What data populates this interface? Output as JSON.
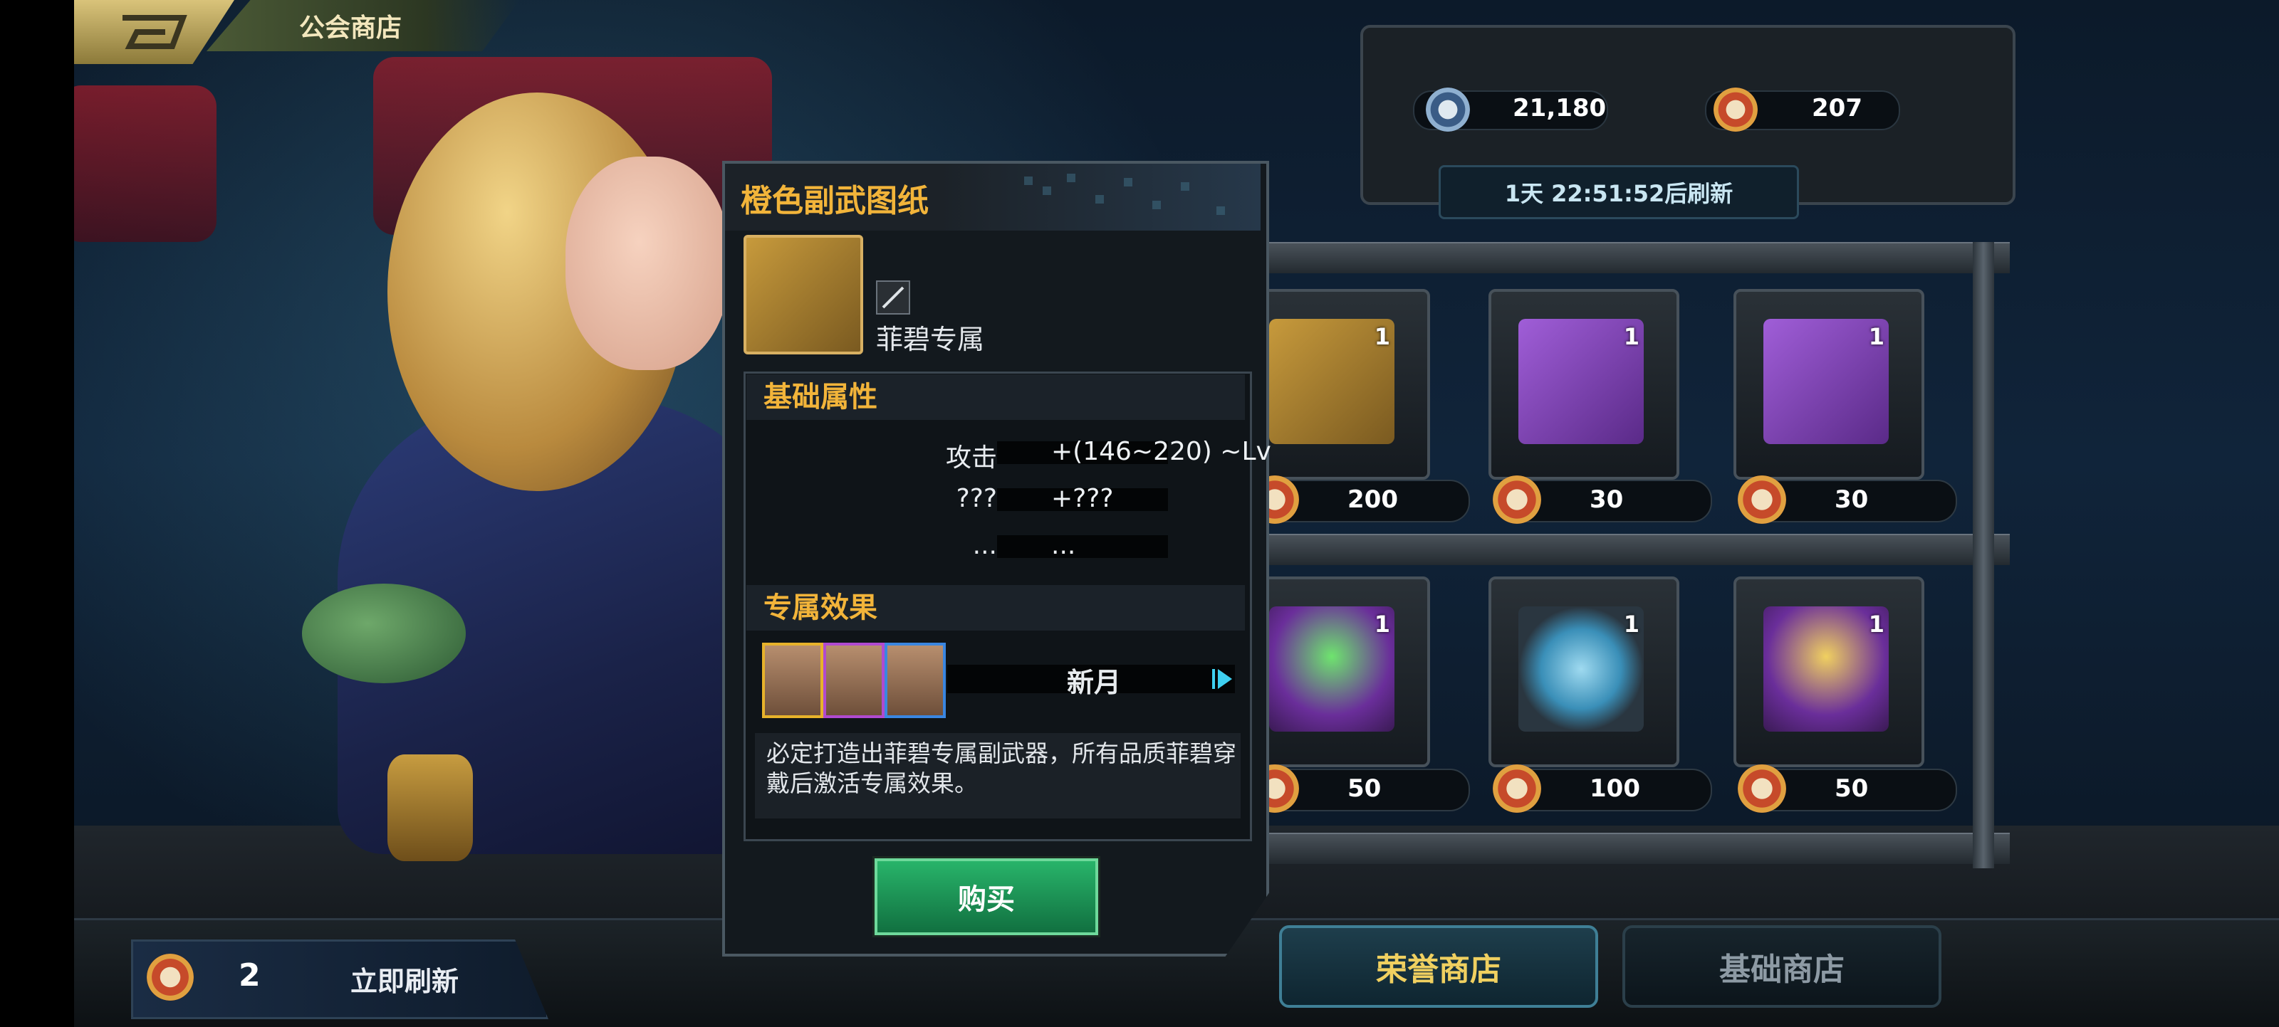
{
  "header": {
    "title": "公会商店",
    "back_icon": "back-arrow-icon"
  },
  "currency": {
    "items": [
      {
        "icon": "blue-guild-coin-icon",
        "value": "21,180"
      },
      {
        "icon": "red-honor-coin-icon",
        "value": "207"
      }
    ],
    "refresh_timer": "1天 22:51:52后刷新"
  },
  "shop_items": [
    {
      "name": "orange-blueprint",
      "qty": "1",
      "price": "200",
      "color": "#c79a3c"
    },
    {
      "name": "purple-weapon-blueprint",
      "qty": "1",
      "price": "30",
      "color": "#8a4fc0"
    },
    {
      "name": "purple-boots-blueprint",
      "qty": "1",
      "price": "30",
      "color": "#8a4fc0"
    },
    {
      "name": "treasure-chest-green",
      "qty": "1",
      "price": "50",
      "color": "#7a3ca8"
    },
    {
      "name": "propeller-part",
      "qty": "1",
      "price": "100",
      "color": "#3a8fb8"
    },
    {
      "name": "treasure-chest-gold",
      "qty": "1",
      "price": "50",
      "color": "#7a3ca8"
    }
  ],
  "popup": {
    "item_name": "橙色副武图纸",
    "exclusive_label": "菲碧专属",
    "basic_attr_header": "基础属性",
    "attributes": [
      {
        "name": "攻击",
        "value": "+(146~220) ~Lv"
      },
      {
        "name": "???",
        "value": "+???"
      },
      {
        "name": "...",
        "value": "..."
      }
    ],
    "exclusive_effect_header": "专属效果",
    "set_name": "新月",
    "character_frames": [
      "#e7b22b",
      "#b04ad0",
      "#3a86e0"
    ],
    "description": "必定打造出菲碧专属副武器，所有品质菲碧穿戴后激活专属效果。",
    "buy_label": "购买"
  },
  "bottom": {
    "refresh_count": "2",
    "refresh_now_label": "立即刷新",
    "tabs": [
      {
        "label": "荣誉商店",
        "active": true
      },
      {
        "label": "基础商店",
        "active": false
      }
    ]
  }
}
